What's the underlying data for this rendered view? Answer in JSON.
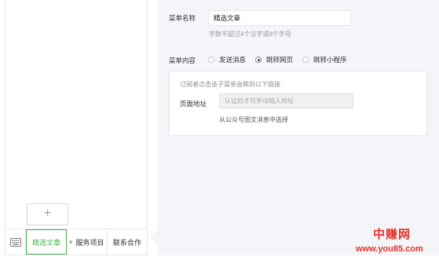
{
  "phone": {
    "add_button": "+",
    "menu_items": [
      {
        "label": "精选文章",
        "active": true
      },
      {
        "label": "服务项目",
        "active": false
      },
      {
        "label": "联系合作",
        "active": false
      }
    ]
  },
  "editor": {
    "name_label": "菜单名称",
    "name_value": "精选文章",
    "name_tip": "字数不超过4个汉字或8个字母",
    "content_label": "菜单内容",
    "options": [
      {
        "label": "发送消息",
        "checked": false
      },
      {
        "label": "跳转网页",
        "checked": true
      },
      {
        "label": "跳转小程序",
        "checked": false
      }
    ],
    "box": {
      "desc": "订阅者点击该子菜单会跳到以下链接",
      "url_label": "页面地址",
      "url_placeholder": "认证后才可手动输入地址",
      "link": "从公众号图文消息中选择"
    }
  },
  "watermark": {
    "title": "中赚网",
    "url": "www.you85.com"
  },
  "colors": {
    "accent": "#44b549",
    "panel_bg": "#f4f5f9",
    "watermark": "#e5322d"
  }
}
